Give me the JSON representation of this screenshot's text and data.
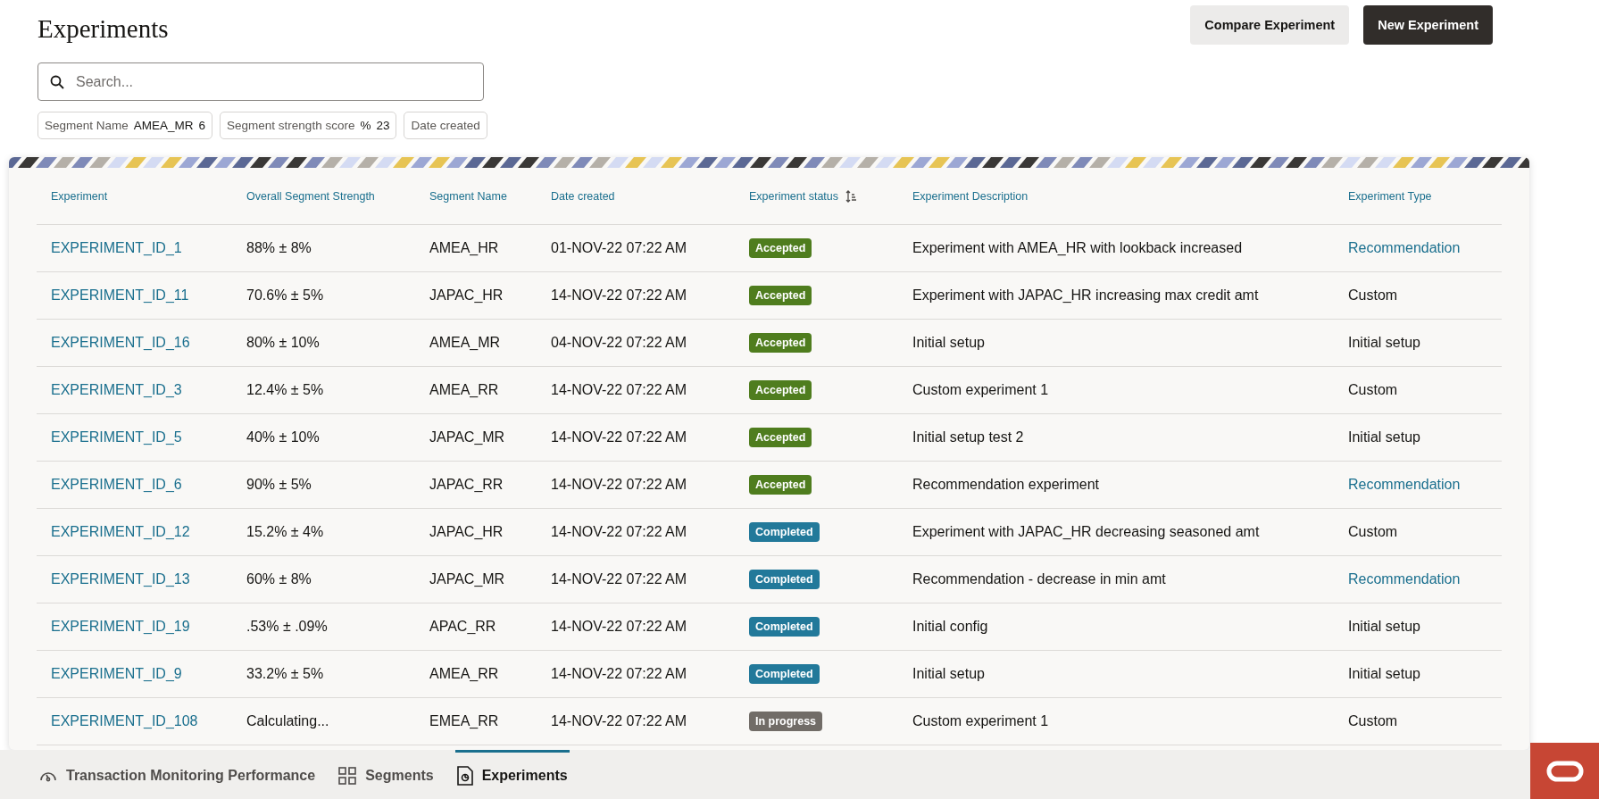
{
  "page": {
    "title": "Experiments"
  },
  "actions": [
    {
      "label": "Compare Experiment",
      "kind": "secondary"
    },
    {
      "label": "New Experiment",
      "kind": "primary"
    }
  ],
  "search": {
    "placeholder": "Search..."
  },
  "filters": [
    {
      "label": "Segment Name",
      "value": "AMEA_MR",
      "count": "6"
    },
    {
      "label": "Segment strength score",
      "value": "%",
      "count": "23"
    },
    {
      "label": "Date created"
    }
  ],
  "table": {
    "columns": [
      {
        "label": "Experiment"
      },
      {
        "label": "Overall Segment Strength"
      },
      {
        "label": "Segment Name"
      },
      {
        "label": "Date created"
      },
      {
        "label": "Experiment status",
        "sortable": true
      },
      {
        "label": "Experiment Description"
      },
      {
        "label": "Experiment Type"
      }
    ],
    "rows": [
      {
        "id": "EXPERIMENT_ID_1",
        "strength": "88% ± 8%",
        "segment": "AMEA_HR",
        "date": "01-NOV-22 07:22 AM",
        "status": {
          "label": "Accepted",
          "kind": "accepted"
        },
        "description": "Experiment with AMEA_HR with lookback increased",
        "type": {
          "label": "Recommendation",
          "kind": "link"
        }
      },
      {
        "id": "EXPERIMENT_ID_11",
        "strength": "70.6% ± 5%",
        "segment": "JAPAC_HR",
        "date": "14-NOV-22 07:22 AM",
        "status": {
          "label": "Accepted",
          "kind": "accepted"
        },
        "description": "Experiment with JAPAC_HR increasing max credit amt",
        "type": {
          "label": "Custom",
          "kind": "text"
        }
      },
      {
        "id": "EXPERIMENT_ID_16",
        "strength": "80% ± 10%",
        "segment": "AMEA_MR",
        "date": "04-NOV-22 07:22 AM",
        "status": {
          "label": "Accepted",
          "kind": "accepted"
        },
        "description": "Initial setup",
        "type": {
          "label": "Initial setup",
          "kind": "text"
        }
      },
      {
        "id": "EXPERIMENT_ID_3",
        "strength": "12.4% ± 5%",
        "segment": "AMEA_RR",
        "date": "14-NOV-22 07:22 AM",
        "status": {
          "label": "Accepted",
          "kind": "accepted"
        },
        "description": "Custom experiment 1",
        "type": {
          "label": "Custom",
          "kind": "text"
        }
      },
      {
        "id": "EXPERIMENT_ID_5",
        "strength": "40% ± 10%",
        "segment": "JAPAC_MR",
        "date": "14-NOV-22 07:22 AM",
        "status": {
          "label": "Accepted",
          "kind": "accepted"
        },
        "description": "Initial setup test 2",
        "type": {
          "label": "Initial setup",
          "kind": "text"
        }
      },
      {
        "id": "EXPERIMENT_ID_6",
        "strength": "90% ± 5%",
        "segment": "JAPAC_RR",
        "date": "14-NOV-22 07:22 AM",
        "status": {
          "label": "Accepted",
          "kind": "accepted"
        },
        "description": "Recommendation experiment",
        "type": {
          "label": "Recommendation",
          "kind": "link"
        }
      },
      {
        "id": "EXPERIMENT_ID_12",
        "strength": "15.2% ± 4%",
        "segment": "JAPAC_HR",
        "date": "14-NOV-22 07:22 AM",
        "status": {
          "label": "Completed",
          "kind": "completed"
        },
        "description": "Experiment with JAPAC_HR decreasing seasoned amt",
        "type": {
          "label": "Custom",
          "kind": "text"
        }
      },
      {
        "id": "EXPERIMENT_ID_13",
        "strength": "60% ± 8%",
        "segment": "JAPAC_MR",
        "date": "14-NOV-22 07:22 AM",
        "status": {
          "label": "Completed",
          "kind": "completed"
        },
        "description": "Recommendation - decrease in min amt",
        "type": {
          "label": "Recommendation",
          "kind": "link"
        }
      },
      {
        "id": "EXPERIMENT_ID_19",
        "strength": ".53% ± .09%",
        "segment": "APAC_RR",
        "date": "14-NOV-22 07:22 AM",
        "status": {
          "label": "Completed",
          "kind": "completed"
        },
        "description": "Initial config",
        "type": {
          "label": "Initial setup",
          "kind": "text"
        }
      },
      {
        "id": "EXPERIMENT_ID_9",
        "strength": "33.2% ± 5%",
        "segment": "AMEA_RR",
        "date": "14-NOV-22 07:22 AM",
        "status": {
          "label": "Completed",
          "kind": "completed"
        },
        "description": "Initial setup",
        "type": {
          "label": "Initial setup",
          "kind": "text"
        }
      },
      {
        "id": "EXPERIMENT_ID_108",
        "strength": "Calculating...",
        "segment": "EMEA_RR",
        "date": "14-NOV-22 07:22 AM",
        "status": {
          "label": "In progress",
          "kind": "in_progress"
        },
        "description": "Custom experiment 1",
        "type": {
          "label": "Custom",
          "kind": "text"
        }
      }
    ]
  },
  "bottom_nav": [
    {
      "label": "Transaction Monitoring Performance",
      "kind": "gauge",
      "selected": false
    },
    {
      "label": "Segments",
      "kind": "grid",
      "selected": false
    },
    {
      "label": "Experiments",
      "kind": "document",
      "selected": true
    }
  ]
}
